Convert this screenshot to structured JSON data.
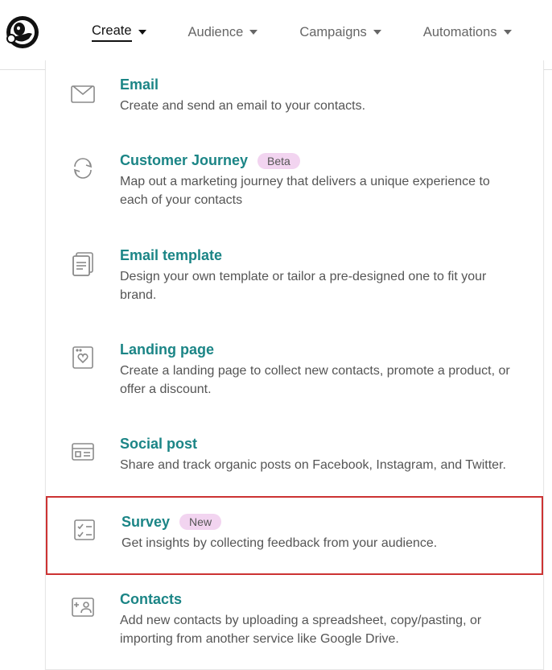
{
  "nav": {
    "create": "Create",
    "audience": "Audience",
    "campaigns": "Campaigns",
    "automations": "Automations"
  },
  "menu": {
    "email": {
      "title": "Email",
      "desc": "Create and send an email to your contacts."
    },
    "journey": {
      "title": "Customer Journey",
      "badge": "Beta",
      "desc": "Map out a marketing journey that delivers a unique experience to each of your contacts"
    },
    "template": {
      "title": "Email template",
      "desc": "Design your own template or tailor a pre-designed one to fit your brand."
    },
    "landing": {
      "title": "Landing page",
      "desc": "Create a landing page to collect new contacts, promote a product, or offer a discount."
    },
    "social": {
      "title": "Social post",
      "desc": "Share and track organic posts on Facebook, Instagram, and Twitter."
    },
    "survey": {
      "title": "Survey",
      "badge": "New",
      "desc": "Get insights by collecting feedback from your audience."
    },
    "contacts": {
      "title": "Contacts",
      "desc": "Add new contacts by uploading a spreadsheet, copy/pasting, or importing from another service like Google Drive."
    }
  }
}
